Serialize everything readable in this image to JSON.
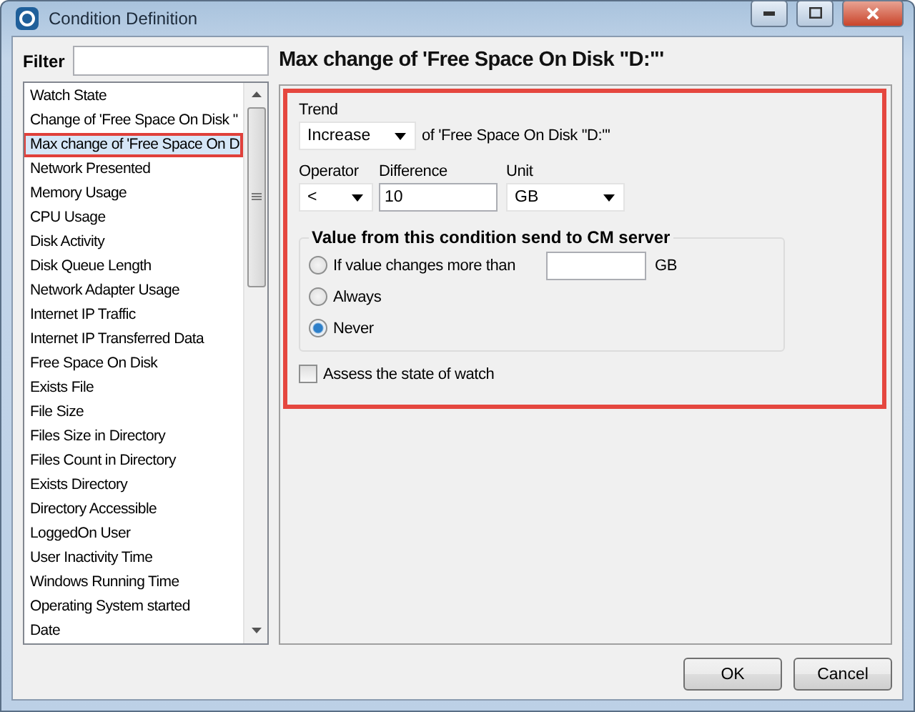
{
  "window": {
    "title": "Condition Definition"
  },
  "filter": {
    "label": "Filter"
  },
  "conditions": [
    {
      "label": "Watch State",
      "selected": false
    },
    {
      "label": "Change of 'Free Space On Disk \"",
      "selected": false
    },
    {
      "label": "Max change of 'Free Space On D",
      "selected": true
    },
    {
      "label": "Network Presented",
      "selected": false
    },
    {
      "label": "Memory Usage",
      "selected": false
    },
    {
      "label": "CPU Usage",
      "selected": false
    },
    {
      "label": "Disk Activity",
      "selected": false
    },
    {
      "label": "Disk Queue Length",
      "selected": false
    },
    {
      "label": "Network Adapter Usage",
      "selected": false
    },
    {
      "label": "Internet IP Traffic",
      "selected": false
    },
    {
      "label": "Internet IP Transferred Data",
      "selected": false
    },
    {
      "label": "Free Space On Disk",
      "selected": false
    },
    {
      "label": "Exists File",
      "selected": false
    },
    {
      "label": "File Size",
      "selected": false
    },
    {
      "label": "Files Size in Directory",
      "selected": false
    },
    {
      "label": "Files Count in Directory",
      "selected": false
    },
    {
      "label": "Exists Directory",
      "selected": false
    },
    {
      "label": "Directory Accessible",
      "selected": false
    },
    {
      "label": "LoggedOn User",
      "selected": false
    },
    {
      "label": "User Inactivity Time",
      "selected": false
    },
    {
      "label": "Windows Running Time",
      "selected": false
    },
    {
      "label": "Operating System started",
      "selected": false
    },
    {
      "label": "Date",
      "selected": false
    }
  ],
  "heading": "Max change of 'Free Space On Disk \"D:\"'",
  "trend": {
    "label": "Trend",
    "value": "Increase",
    "suffix": "of 'Free Space On Disk \"D:\"'"
  },
  "operator": {
    "label": "Operator",
    "value": "<"
  },
  "difference": {
    "label": "Difference",
    "value": "10"
  },
  "unit": {
    "label": "Unit",
    "value": "GB"
  },
  "send_group": {
    "title": "Value from this condition send to CM server",
    "options": [
      {
        "label": "If value changes more than",
        "selected": false,
        "field_unit": "GB"
      },
      {
        "label": "Always",
        "selected": false
      },
      {
        "label": "Never",
        "selected": true
      }
    ]
  },
  "assess": {
    "label": "Assess the state of watch",
    "checked": false
  },
  "buttons": [
    "OK",
    "Cancel"
  ]
}
